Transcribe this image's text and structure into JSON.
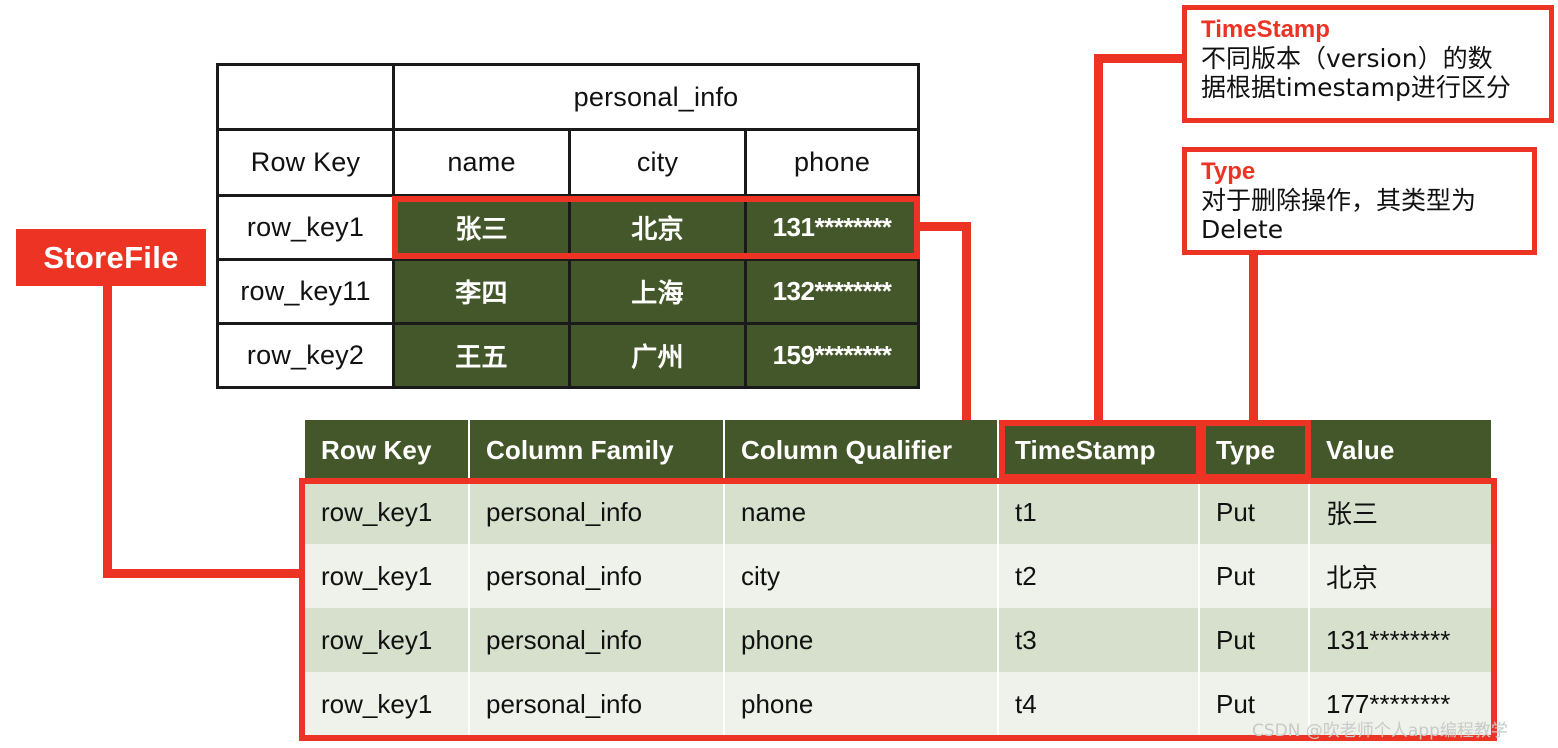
{
  "badge": {
    "label": "StoreFile"
  },
  "top_table": {
    "family_header": "personal_info",
    "corner": "",
    "columns": [
      "Row Key",
      "name",
      "city",
      "phone"
    ],
    "rows": [
      {
        "row_key": "row_key1",
        "name": "张三",
        "city": "北京",
        "phone": "131********"
      },
      {
        "row_key": "row_key11",
        "name": "李四",
        "city": "上海",
        "phone": "132********"
      },
      {
        "row_key": "row_key2",
        "name": "王五",
        "city": "广州",
        "phone": "159********"
      }
    ]
  },
  "bottom_table": {
    "headers": [
      "Row Key",
      "Column Family",
      "Column Qualifier",
      "TimeStamp",
      "Type",
      "Value"
    ],
    "rows": [
      {
        "row_key": "row_key1",
        "column_family": "personal_info",
        "column_qualifier": "name",
        "timestamp": "t1",
        "type": "Put",
        "value": "张三"
      },
      {
        "row_key": "row_key1",
        "column_family": "personal_info",
        "column_qualifier": "city",
        "timestamp": "t2",
        "type": "Put",
        "value": "北京"
      },
      {
        "row_key": "row_key1",
        "column_family": "personal_info",
        "column_qualifier": "phone",
        "timestamp": "t3",
        "type": "Put",
        "value": "131********"
      },
      {
        "row_key": "row_key1",
        "column_family": "personal_info",
        "column_qualifier": "phone",
        "timestamp": "t4",
        "type": "Put",
        "value": "177********"
      }
    ]
  },
  "callouts": {
    "timestamp": {
      "title": "TimeStamp",
      "line1": "不同版本（version）的数",
      "line2": "据根据timestamp进行区分"
    },
    "type": {
      "title": "Type",
      "line1": "对于删除操作，其类型为",
      "line2": "Delete"
    }
  },
  "watermark": {
    "text": "CSDN @吹老师个人app编程教学"
  },
  "colors": {
    "accent_red": "#ed3324",
    "dark_green": "#44572a",
    "row_green_a": "#d6e0cd",
    "row_green_b": "#eef2ea",
    "border_black": "#1a1a1a"
  }
}
